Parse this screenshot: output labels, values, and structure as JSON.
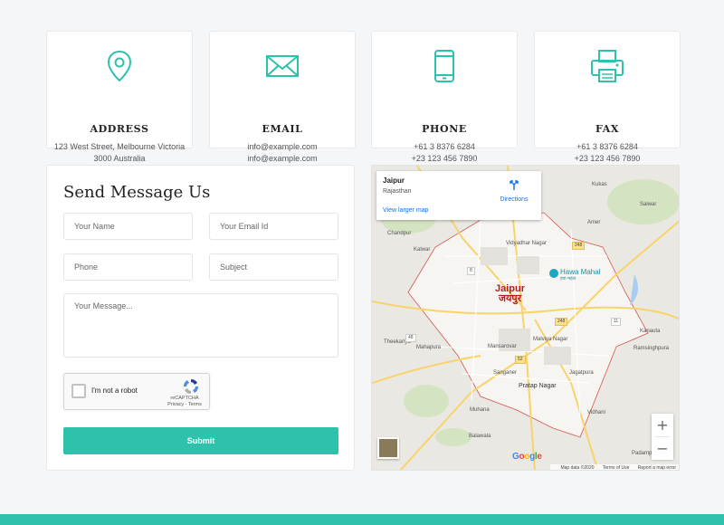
{
  "accent_color": "#2ec2ad",
  "contact_cards": [
    {
      "icon": "location-pin-icon",
      "title": "ADDRESS",
      "lines": [
        "123 West Street, Melbourne Victoria",
        "3000 Australia"
      ]
    },
    {
      "icon": "envelope-icon",
      "title": "EMAIL",
      "lines": [
        "info@example.com",
        "info@example.com"
      ]
    },
    {
      "icon": "smartphone-icon",
      "title": "PHONE",
      "lines": [
        "+61 3 8376 6284",
        "+23 123 456 7890"
      ]
    },
    {
      "icon": "printer-icon",
      "title": "FAX",
      "lines": [
        "+61 3 8376 6284",
        "+23 123 456 7890"
      ]
    }
  ],
  "form": {
    "title": "Send Message Us",
    "name_placeholder": "Your Name",
    "email_placeholder": "Your Email Id",
    "phone_placeholder": "Phone",
    "subject_placeholder": "Subject",
    "message_placeholder": "Your Message...",
    "captcha_label": "I'm not a robot",
    "captcha_brand": "reCAPTCHA",
    "captcha_links": "Privacy - Terms",
    "submit_label": "Submit"
  },
  "map": {
    "place_name": "Jaipur",
    "place_region": "Rajasthan",
    "directions_label": "Directions",
    "larger_map_label": "View larger map",
    "city_label_en": "Jaipur",
    "city_label_hi": "जयपुर",
    "landmark": "Hawa Mahal",
    "landmark_hi": "हवा महल",
    "area_labels": [
      "Kukas",
      "Chandpur",
      "Saiwar",
      "Kalwar",
      "Vidyadhar Nagar",
      "Amer",
      "Mansarovar",
      "Malviya Nagar",
      "Sanganer",
      "Jagatpura",
      "Pratap Nagar",
      "Mahapura",
      "Theekariya",
      "Muhana",
      "Balawala",
      "Vidhani",
      "Kanauta",
      "Ramsinghpura",
      "Padamp"
    ],
    "road_numbers": [
      "248",
      "48",
      "52",
      "8",
      "11"
    ],
    "zoom_in": "+",
    "zoom_out": "−",
    "google_logo": "Google",
    "map_data": "Map data ©2020",
    "terms": "Terms of Use",
    "report": "Report a map error"
  }
}
